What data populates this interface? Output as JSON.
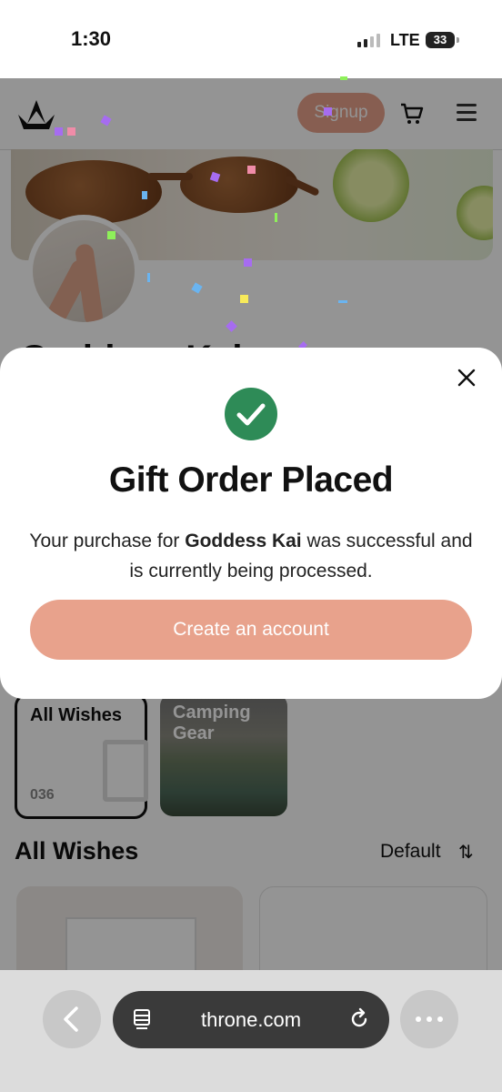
{
  "status": {
    "time": "1:30",
    "network": "LTE",
    "battery": "33"
  },
  "nav": {
    "signup_label": "Signup",
    "logo_icon": "crown-icon",
    "cart_icon": "cart-icon",
    "menu_icon": "hamburger-menu-icon"
  },
  "profile": {
    "name": "Goddess Kai"
  },
  "collections": [
    {
      "title": "All Wishes",
      "count": "036"
    },
    {
      "title": "Camping Gear"
    }
  ],
  "wishlist": {
    "heading": "All Wishes",
    "sort_label": "Default",
    "sort_icon": "sort-arrows-icon"
  },
  "modal": {
    "title": "Gift Order Placed",
    "message_prefix": "Your purchase for ",
    "recipient": "Goddess Kai",
    "message_suffix": " was successful and is currently being processed.",
    "cta_label": "Create an account",
    "close_icon": "close-icon",
    "status_icon": "check-circle-icon"
  },
  "browser": {
    "url": "throne.com"
  },
  "colors": {
    "accent": "#E8A28C",
    "success": "#2E8B57",
    "overlay": "rgba(0,0,0,0.42)"
  }
}
